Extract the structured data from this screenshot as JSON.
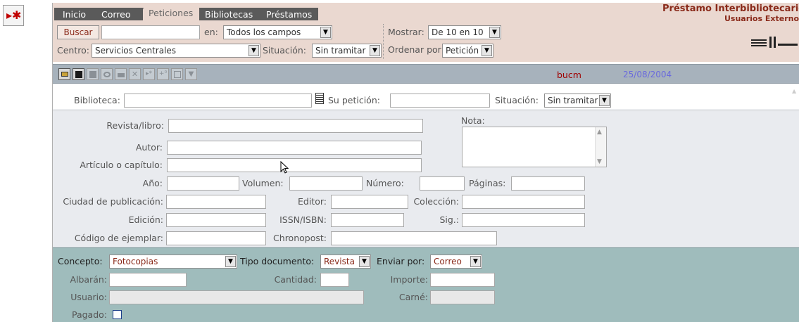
{
  "app_title": "Préstamo Interbibliotecario",
  "app_subtitle": "Usuarios Externos",
  "side_button": "▸✱",
  "tabs": [
    {
      "label": "Inicio"
    },
    {
      "label": "Correo"
    },
    {
      "label": "Peticiones"
    },
    {
      "label": "Bibliotecas"
    },
    {
      "label": "Préstamos"
    }
  ],
  "search": {
    "button": "Buscar",
    "value": "",
    "en_label": "en:",
    "en_value": "Todos los campos",
    "mostrar_label": "Mostrar:",
    "mostrar_value": "De 10 en 10",
    "centro_label": "Centro:",
    "centro_value": "Servicios Centrales",
    "situacion_label": "Situación:",
    "situacion_value": "Sin tramitar",
    "ordenar_label": "Ordenar por:",
    "ordenar_value": "Petición"
  },
  "toolbar": {
    "user": "bucm",
    "date": "25/08/2004"
  },
  "request": {
    "biblioteca_label": "Biblioteca:",
    "su_peticion_label": "Su petición:",
    "situacion_label": "Situación:",
    "situacion_value": "Sin tramitar"
  },
  "record": {
    "revista_label": "Revista/libro:",
    "nota_label": "Nota:",
    "autor_label": "Autor:",
    "articulo_label": "Artículo o capítulo:",
    "anio_label": "Año:",
    "volumen_label": "Volumen:",
    "numero_label": "Número:",
    "paginas_label": "Páginas:",
    "ciudad_label": "Ciudad de publicación:",
    "editor_label": "Editor:",
    "coleccion_label": "Colección:",
    "edicion_label": "Edición:",
    "issn_label": "ISSN/ISBN:",
    "sig_label": "Sig.:",
    "codigo_label": "Código de ejemplar:",
    "chronopost_label": "Chronopost:"
  },
  "billing": {
    "concepto_label": "Concepto:",
    "concepto_value": "Fotocopias",
    "tipo_label": "Tipo documento:",
    "tipo_value": "Revista",
    "enviar_label": "Enviar por:",
    "enviar_value": "Correo",
    "albaran_label": "Albarán:",
    "cantidad_label": "Cantidad:",
    "importe_label": "Importe:",
    "usuario_label": "Usuario:",
    "carne_label": "Carné:",
    "pagado_label": "Pagado:"
  },
  "colors": {
    "header_bg": "#ead8d0",
    "tab_bg": "#5a5a5a",
    "toolbar_bg": "#a7b2bc",
    "billing_bg": "#9fbcbc",
    "accent_text": "#8a2a1a",
    "date_text": "#6a6add"
  }
}
